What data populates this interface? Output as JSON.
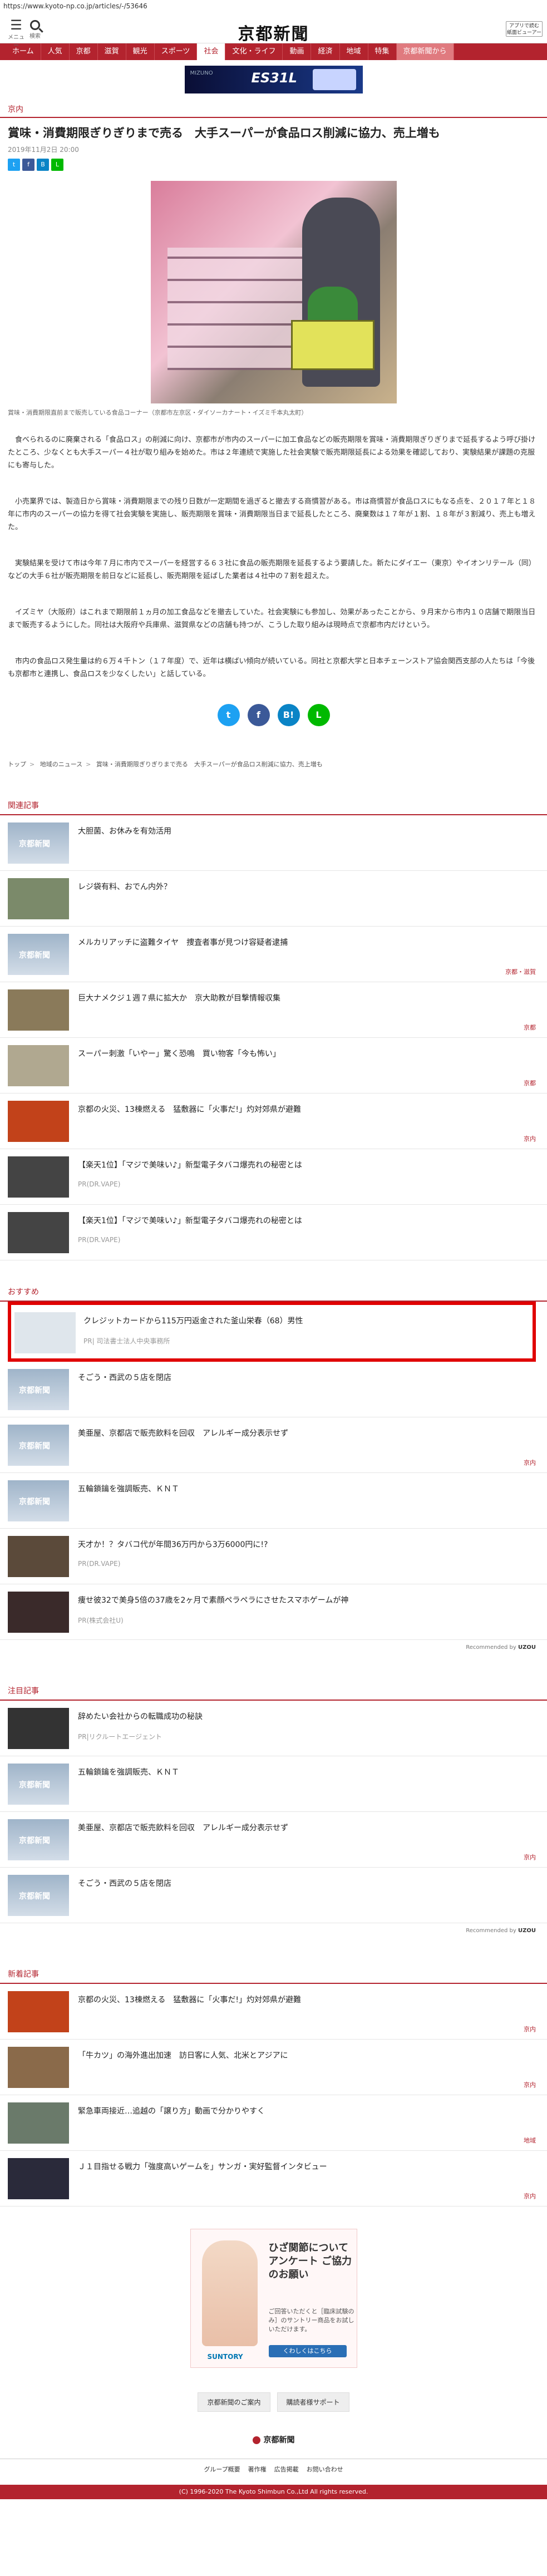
{
  "browser": {
    "url": "https://www.kyoto-np.co.jp/articles/-/53646"
  },
  "header": {
    "logo": "京都新聞",
    "menu_label": "メニュー",
    "search_label": "検索",
    "premium_label": "アプリで読む 紙面ビューアー"
  },
  "nav": {
    "items": [
      "ホーム",
      "人気",
      "京都",
      "滋賀",
      "観光",
      "スポーツ",
      "社会",
      "文化・ライフ",
      "動画",
      "経済",
      "地域",
      "観光",
      "特集"
    ],
    "active": "社会",
    "more": "京都新聞から"
  },
  "ad_top": {
    "brand": "MIZUNO",
    "product": "ES31L"
  },
  "article": {
    "section": "京内",
    "title": "賞味・消費期限ぎりぎりまで売る　大手スーパーが食品ロス削減に協力、売上増も",
    "date": "2019年11月2日 20:00",
    "caption": "賞味・消費期限直前まで販売している食品コーナー（京都市左京区・ダイソーカナート・イズミ千本丸太町）",
    "paragraphs": [
      "食べられるのに廃棄される「食品ロス」の削減に向け、京都市が市内のスーパーに加工食品などの販売期限を賞味・消費期限ぎりぎりまで延長するよう呼び掛けたところ、少なくとも大手スーパー４社が取り組みを始めた。市は２年連続で実施した社会実験で販売期限延長による効果を確認しており、実験結果が課題の克服にも寄与した。",
      "小売業界では、製造日から賞味・消費期限までの残り日数が一定期間を過ぎると撤去する商慣習がある。市は商慣習が食品ロスにもなる点を、２０１７年と１８年に市内のスーパーの協力を得て社会実験を実施し、販売期限を賞味・消費期限当日まで延長したところ、廃棄数は１７年が１割、１８年が３割減り、売上も増えた。",
      "実験結果を受けて市は今年７月に市内でスーパーを経営する６３社に食品の販売期限を延長するよう要請した。新たにダイエー（東京）やイオンリテール（同）などの大手６社が販売期限を前日などに延長し、販売期限を延ばした業者は４社中の７割を超えた。",
      "イズミヤ（大阪府）はこれまで期限前１ヵ月の加工食品などを撤去していた。社会実験にも参加し、効果があったことから、９月末から市内１０店舗で期限当日まで販売するようにした。同社は大阪府や兵庫県、滋賀県などの店舗も持つが、こうした取り組みは現時点で京都市内だけという。",
      "市内の食品ロス発生量は約６万４千トン（１７年度）で、近年は横ばい傾向が続いている。同社と京都大学と日本チェーンストア協会関西支部の人たちは「今後も京都市と連携し、食品ロスを少なくしたい」と話している。"
    ]
  },
  "breadcrumb": [
    "トップ",
    "地域のニュース",
    "賞味・消費期限ぎりぎりまで売る　大手スーパーが食品ロス削減に協力、売上増も"
  ],
  "related": {
    "heading": "関連記事",
    "items": [
      {
        "title": "大胆菌、お休みを有効活用",
        "tag": ""
      },
      {
        "title": "レジ袋有料、おでん内外？",
        "tag": ""
      },
      {
        "title": "メルカリアッチに盗難タイヤ　捜査者事が見つけ容疑者逮捕",
        "tag": "京都・滋賀"
      },
      {
        "title": "巨大ナメクジ１週７県に拡大か　京大助教が目撃情報収集",
        "tag": "京都"
      },
      {
        "title": "スーパー刺激「いやー」驚く恐鳴　買い物客「今も怖い」",
        "tag": "京都"
      },
      {
        "title": "京都の火災、13棟燃える　猛敷器に「火事だ!」灼対郊県が避難",
        "tag": "京内"
      },
      {
        "title": "【楽天1位】「マジで美味い♪」新型電子タバコ爆売れの秘密とは",
        "tag": "PR(DR.VAPE)"
      },
      {
        "title": "【楽天1位】「マジで美味い♪」新型電子タバコ爆売れの秘密とは",
        "tag": "PR(DR.VAPE)"
      }
    ]
  },
  "recommended": {
    "heading": "おすすめ",
    "items": [
      {
        "title": "クレジットカードから115万円返金された釜山栄春（68）男性",
        "sub": "PR| 司法書士法人中央事務所",
        "tag": ""
      },
      {
        "title": "そごう・西武の５店を閉店",
        "sub": "",
        "tag": ""
      },
      {
        "title": "美亜屋、京都店で販売飲料を回収　アレルギー成分表示せず",
        "sub": "",
        "tag": "京内"
      },
      {
        "title": "五輪鎖鑰を強調販売、ＫＮＴ",
        "sub": "",
        "tag": ""
      },
      {
        "title": "天才か！？タバコ代が年間36万円から3万6000円に!?",
        "sub": "PR(DR.VAPE)",
        "tag": ""
      },
      {
        "title": "痩せ彼32で美身5倍の37歳を2ヶ月で素顔ペラペラにさせたスマホゲームが神",
        "sub": "PR(株式会社U)",
        "tag": ""
      }
    ],
    "recommended_by": "Recommended by "
  },
  "featured": {
    "heading": "注目記事",
    "items": [
      {
        "title": "辞めたい会社からの転職成功の秘訣",
        "sub": "PR|リクルートエージェント",
        "tag": ""
      },
      {
        "title": "五輪鎖鑰を強調販売、ＫＮＴ",
        "sub": "",
        "tag": ""
      },
      {
        "title": "美亜屋、京都店で販売飲料を回収　アレルギー成分表示せず",
        "sub": "",
        "tag": "京内"
      },
      {
        "title": "そごう・西武の５店を閉店",
        "sub": "",
        "tag": ""
      }
    ],
    "recommended_by": "Recommended by "
  },
  "latest": {
    "heading": "新着記事",
    "items": [
      {
        "title": "京都の火災、13棟燃える　猛敷器に「火事だ!」灼対郊県が避難",
        "tag": "京内"
      },
      {
        "title": "「牛カツ」の海外進出加速　訪日客に人気、北米とアジアに",
        "tag": "京内"
      },
      {
        "title": "緊急車両接近…追越の「譲り方」動画で分かりやすく",
        "tag": "地域"
      },
      {
        "title": "Ｊ１目指せる戦力「強度高いゲームを」サンガ・実好監督インタビュー",
        "tag": "京内"
      }
    ]
  },
  "ad_bottom": {
    "headline": "ひざ関節について アンケート ご協力のお願い",
    "body": "ご回答いただくと［臨床試験のみ］のサントリー商品をお試しいただけます。",
    "brand": "SUNTORY",
    "button": "くわしくはこちら"
  },
  "footer": {
    "links": [
      "京都新聞のご案内",
      "購読者様サポート"
    ],
    "logo": "京都新聞",
    "bottom_nav": [
      "グループ概要",
      "著作権",
      "広告掲載",
      "お問い合わせ"
    ],
    "copyright": "(C) 1996-2020 The Kyoto Shimbun Co.,Ltd All rights reserved."
  }
}
